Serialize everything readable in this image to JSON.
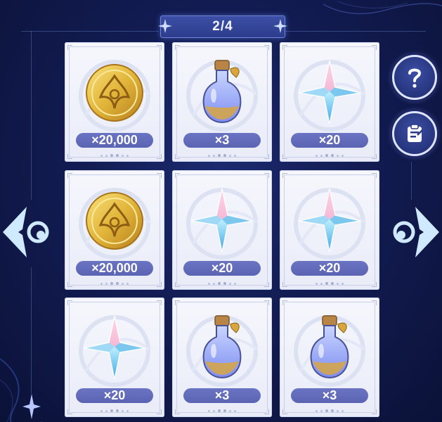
{
  "page_indicator": {
    "text": "2/4"
  },
  "rewards": [
    {
      "item": "gold-coin",
      "quantity": "×20,000"
    },
    {
      "item": "potion-bottle",
      "quantity": "×3"
    },
    {
      "item": "crystal-star",
      "quantity": "×20"
    },
    {
      "item": "gold-coin",
      "quantity": "×20,000"
    },
    {
      "item": "crystal-star",
      "quantity": "×20"
    },
    {
      "item": "crystal-star",
      "quantity": "×20"
    },
    {
      "item": "crystal-star",
      "quantity": "×20"
    },
    {
      "item": "potion-bottle",
      "quantity": "×3"
    },
    {
      "item": "potion-bottle",
      "quantity": "×3"
    }
  ],
  "side_buttons": [
    {
      "icon": "question-mark-icon"
    },
    {
      "icon": "clipboard-icon"
    }
  ],
  "navigation": {
    "prev_icon": "arrow-left-icon",
    "next_icon": "arrow-right-icon"
  },
  "colors": {
    "background": "#121c52",
    "card": "#f2f4fc",
    "quantity_pill": "#5f69b8",
    "gold": "#e2b53a",
    "crystal": "#8fd3f2"
  }
}
